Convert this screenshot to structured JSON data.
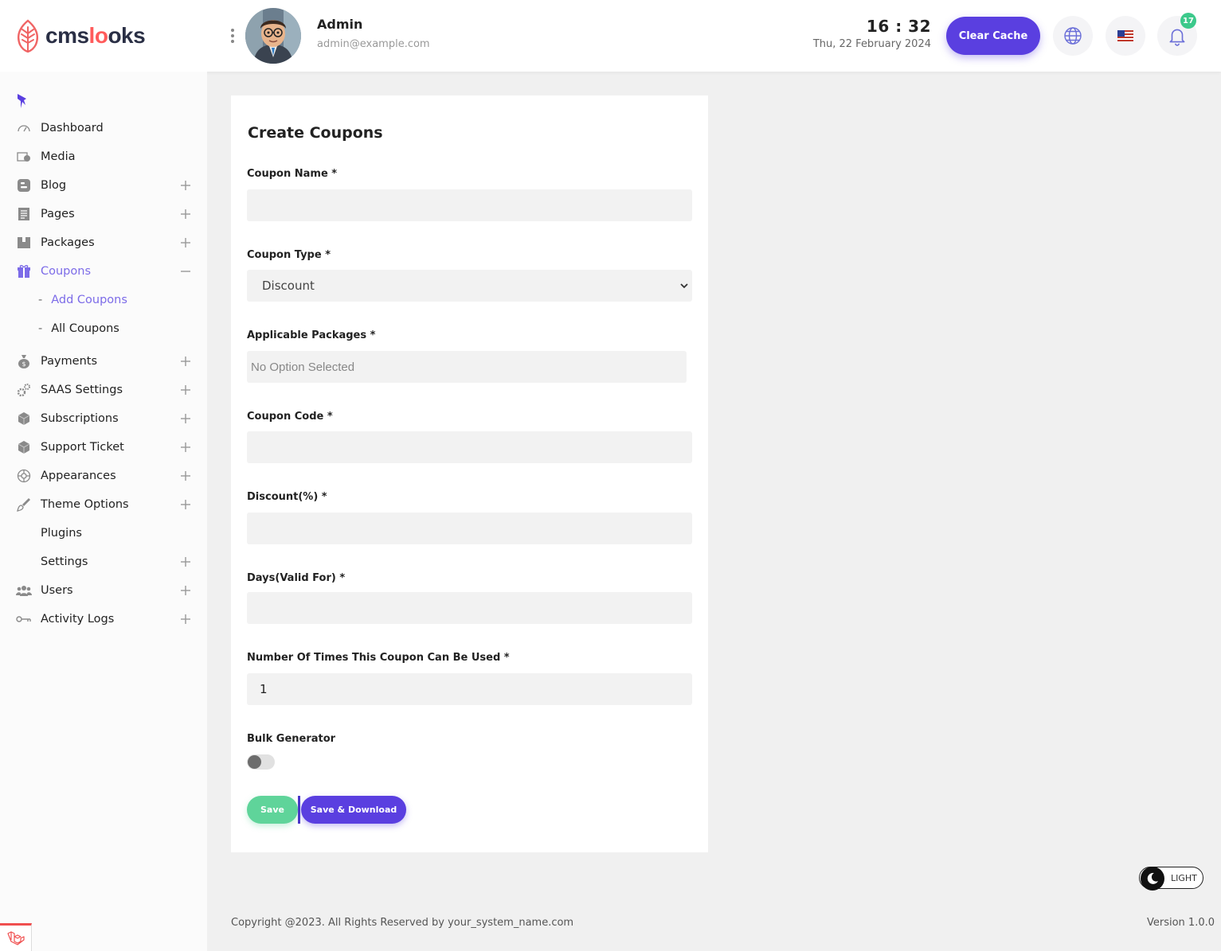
{
  "header": {
    "logo": {
      "part1": "cms",
      "part2": "lo",
      "part3": "oks"
    },
    "user_name": "Admin",
    "user_email": "admin@example.com",
    "time": "16 : 32",
    "date": "Thu, 22 February 2024",
    "clear_cache_label": "Clear Cache",
    "notification_count": "17",
    "icons": [
      "globe-icon",
      "us-flag-icon",
      "bell-icon"
    ]
  },
  "sidebar": {
    "items": [
      {
        "label": "Dashboard",
        "icon": "speedometer-icon",
        "expandable": false
      },
      {
        "label": "Media",
        "icon": "media-icon",
        "expandable": false
      },
      {
        "label": "Blog",
        "icon": "blogger-icon",
        "expandable": true
      },
      {
        "label": "Pages",
        "icon": "page-icon",
        "expandable": true
      },
      {
        "label": "Packages",
        "icon": "package-icon",
        "expandable": true
      },
      {
        "label": "Coupons",
        "icon": "gift-icon",
        "expandable": true,
        "expanded": true,
        "active": true
      },
      {
        "label": "Payments",
        "icon": "money-bag-icon",
        "expandable": true
      },
      {
        "label": "SAAS Settings",
        "icon": "gears-icon",
        "expandable": true
      },
      {
        "label": "Subscriptions",
        "icon": "box-icon",
        "expandable": true
      },
      {
        "label": "Support Ticket",
        "icon": "box-icon",
        "expandable": true
      },
      {
        "label": "Appearances",
        "icon": "palette-icon",
        "expandable": true
      },
      {
        "label": "Theme Options",
        "icon": "brush-icon",
        "expandable": true
      },
      {
        "label": "Plugins",
        "icon": "",
        "expandable": false
      },
      {
        "label": "Settings",
        "icon": "",
        "expandable": true
      },
      {
        "label": "Users",
        "icon": "users-icon",
        "expandable": true
      },
      {
        "label": "Activity Logs",
        "icon": "key-icon",
        "expandable": true
      }
    ],
    "coupon_subitems": [
      {
        "label": "Add Coupons",
        "active": true
      },
      {
        "label": "All Coupons",
        "active": false
      }
    ]
  },
  "form": {
    "title": "Create Coupons",
    "coupon_name_label": "Coupon Name *",
    "coupon_name_value": "",
    "coupon_type_label": "Coupon Type *",
    "coupon_type_value": "Discount",
    "applicable_packages_label": "Applicable Packages *",
    "applicable_packages_placeholder": "No Option Selected",
    "coupon_code_label": "Coupon Code *",
    "coupon_code_value": "",
    "discount_label": "Discount(%) *",
    "discount_value": "",
    "days_label": "Days(Valid For) *",
    "days_value": "",
    "times_label": "Number Of Times This Coupon Can Be Used *",
    "times_value": "1",
    "bulk_label": "Bulk Generator",
    "bulk_enabled": false,
    "save_label": "Save",
    "save_download_label": "Save & Download"
  },
  "theme": {
    "mode_label": "LIGHT"
  },
  "footer": {
    "copyright": "Copyright @2023. All Rights Reserved by your_system_name.com",
    "version": "Version 1.0.0"
  },
  "colors": {
    "accent": "#5a3fe0",
    "success": "#5fd49a",
    "active_nav": "#7c6be8",
    "brand_red": "#ff5b5b"
  }
}
